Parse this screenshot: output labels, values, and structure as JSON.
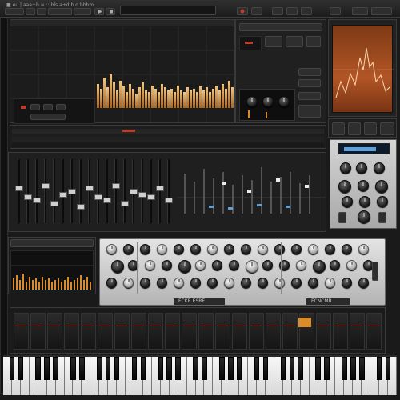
{
  "app": {
    "title_bar_text": "■ eu | aaa+b  ≡ :: bls a+d b.d bbbm"
  },
  "colors": {
    "accent_orange": "#d98c2b",
    "accent_red": "#c0392b",
    "screen_rust": "#9c4a1e",
    "lcd_blue": "#5fa0d8",
    "panel_silver": "#cfcfcf"
  },
  "levels": {
    "mixer_faders": [
      0.55,
      0.4,
      0.35,
      0.6,
      0.3,
      0.45,
      0.5,
      0.25,
      0.55,
      0.4,
      0.35,
      0.6,
      0.3,
      0.5,
      0.45,
      0.4,
      0.55,
      0.35
    ]
  },
  "icons": [
    "play-icon",
    "stop-icon",
    "record-icon",
    "loop-icon",
    "settings-icon"
  ],
  "synth": {
    "name_plate": "FCKR ESRE",
    "right_plate": "FCNCMR"
  }
}
